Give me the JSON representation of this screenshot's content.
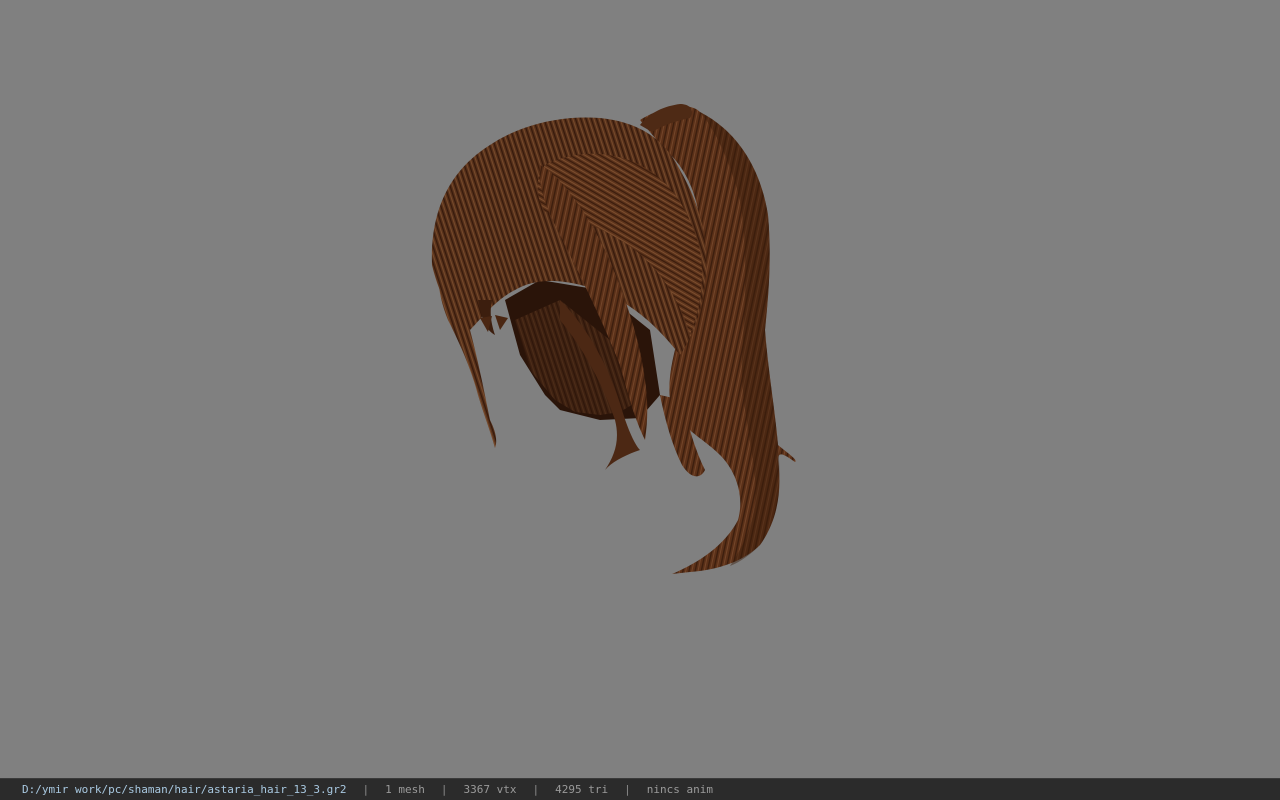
{
  "status_bar": {
    "file_path": "D:/ymir work/pc/shaman/hair/astaria_hair_13_3.gr2",
    "separator": "|",
    "mesh_count": "1 mesh",
    "vertex_count": "3367 vtx",
    "triangle_count": "4295 tri",
    "anim": "nincs anim"
  },
  "colors": {
    "viewport_background": "#808080",
    "status_bar_background": "#2b2b2b",
    "hair_base": "#5a3018",
    "hair_dark": "#2e160a",
    "hair_light": "#7a4a2a"
  }
}
